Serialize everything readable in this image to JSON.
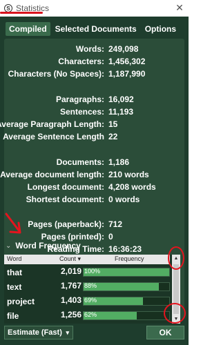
{
  "window": {
    "title": "Statistics",
    "close_glyph": "✕",
    "app_icon": "scrivener-s-icon",
    "app_icon_glyph": "S"
  },
  "tabs": [
    {
      "label": "Compiled",
      "active": true
    },
    {
      "label": "Selected Documents",
      "active": false
    },
    {
      "label": "Options",
      "active": false
    }
  ],
  "stats": [
    {
      "label": "Words:",
      "value": "249,098"
    },
    {
      "label": "Characters:",
      "value": "1,456,302"
    },
    {
      "label": "Characters (No Spaces):",
      "value": "1,187,990"
    },
    {
      "label": "Paragraphs:",
      "value": "16,092"
    },
    {
      "label": "Sentences:",
      "value": "11,193"
    },
    {
      "label": "Average Paragraph Length:",
      "value": "15"
    },
    {
      "label": "Average Sentence Length",
      "value": "22"
    },
    {
      "label": "Documents:",
      "value": "1,186"
    },
    {
      "label": "Average document length:",
      "value": "210 words"
    },
    {
      "label": "Longest document:",
      "value": "4,208 words"
    },
    {
      "label": "Shortest document:",
      "value": "0 words"
    },
    {
      "label": "Pages (paperback):",
      "value": "712"
    },
    {
      "label": "Pages (printed):",
      "value": "0"
    },
    {
      "label": "Reading Time:",
      "value": "16:36:23"
    }
  ],
  "word_frequency": {
    "title": "Word Frequency",
    "chevron": "⌄",
    "columns": {
      "word": "Word",
      "count": "Count ▾",
      "frequency": "Frequency"
    },
    "rows": [
      {
        "word": "that",
        "count": "2,019",
        "pct_label": "100%",
        "pct": 100
      },
      {
        "word": "text",
        "count": "1,767",
        "pct_label": "88%",
        "pct": 88
      },
      {
        "word": "project",
        "count": "1,403",
        "pct_label": "69%",
        "pct": 69
      },
      {
        "word": "file",
        "count": "1,256",
        "pct_label": "62%",
        "pct": 62
      }
    ],
    "scroll_up": "▲",
    "scroll_down": "▼"
  },
  "footer": {
    "estimate_select": "Estimate (Fast)",
    "select_caret": "▾",
    "ok_label": "OK"
  },
  "colors": {
    "dialog_bg": "#1e3d2d",
    "panel_bg": "#2b4d39",
    "bar_fill": "#52ad63",
    "annotation_red": "#e4141e"
  }
}
